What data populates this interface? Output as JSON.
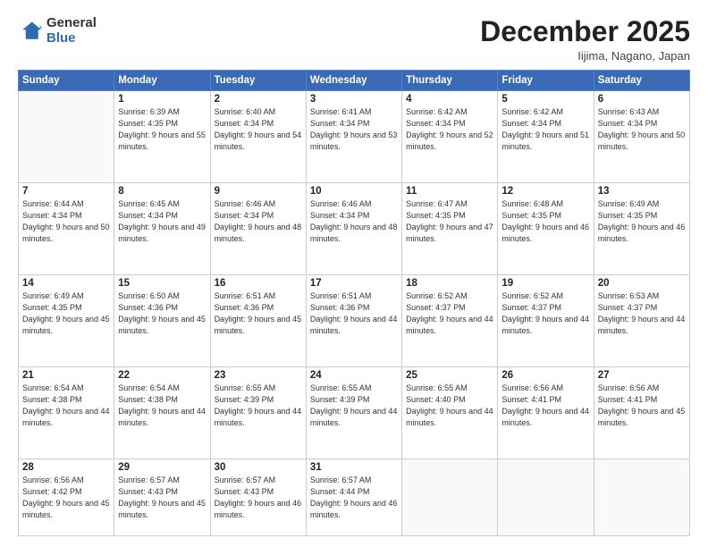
{
  "logo": {
    "general": "General",
    "blue": "Blue"
  },
  "title": "December 2025",
  "location": "Iijima, Nagano, Japan",
  "weekdays": [
    "Sunday",
    "Monday",
    "Tuesday",
    "Wednesday",
    "Thursday",
    "Friday",
    "Saturday"
  ],
  "weeks": [
    [
      {
        "day": "",
        "info": ""
      },
      {
        "day": "1",
        "info": "Sunrise: 6:39 AM\nSunset: 4:35 PM\nDaylight: 9 hours\nand 55 minutes."
      },
      {
        "day": "2",
        "info": "Sunrise: 6:40 AM\nSunset: 4:34 PM\nDaylight: 9 hours\nand 54 minutes."
      },
      {
        "day": "3",
        "info": "Sunrise: 6:41 AM\nSunset: 4:34 PM\nDaylight: 9 hours\nand 53 minutes."
      },
      {
        "day": "4",
        "info": "Sunrise: 6:42 AM\nSunset: 4:34 PM\nDaylight: 9 hours\nand 52 minutes."
      },
      {
        "day": "5",
        "info": "Sunrise: 6:42 AM\nSunset: 4:34 PM\nDaylight: 9 hours\nand 51 minutes."
      },
      {
        "day": "6",
        "info": "Sunrise: 6:43 AM\nSunset: 4:34 PM\nDaylight: 9 hours\nand 50 minutes."
      }
    ],
    [
      {
        "day": "7",
        "info": "Sunrise: 6:44 AM\nSunset: 4:34 PM\nDaylight: 9 hours\nand 50 minutes."
      },
      {
        "day": "8",
        "info": "Sunrise: 6:45 AM\nSunset: 4:34 PM\nDaylight: 9 hours\nand 49 minutes."
      },
      {
        "day": "9",
        "info": "Sunrise: 6:46 AM\nSunset: 4:34 PM\nDaylight: 9 hours\nand 48 minutes."
      },
      {
        "day": "10",
        "info": "Sunrise: 6:46 AM\nSunset: 4:34 PM\nDaylight: 9 hours\nand 48 minutes."
      },
      {
        "day": "11",
        "info": "Sunrise: 6:47 AM\nSunset: 4:35 PM\nDaylight: 9 hours\nand 47 minutes."
      },
      {
        "day": "12",
        "info": "Sunrise: 6:48 AM\nSunset: 4:35 PM\nDaylight: 9 hours\nand 46 minutes."
      },
      {
        "day": "13",
        "info": "Sunrise: 6:49 AM\nSunset: 4:35 PM\nDaylight: 9 hours\nand 46 minutes."
      }
    ],
    [
      {
        "day": "14",
        "info": "Sunrise: 6:49 AM\nSunset: 4:35 PM\nDaylight: 9 hours\nand 45 minutes."
      },
      {
        "day": "15",
        "info": "Sunrise: 6:50 AM\nSunset: 4:36 PM\nDaylight: 9 hours\nand 45 minutes."
      },
      {
        "day": "16",
        "info": "Sunrise: 6:51 AM\nSunset: 4:36 PM\nDaylight: 9 hours\nand 45 minutes."
      },
      {
        "day": "17",
        "info": "Sunrise: 6:51 AM\nSunset: 4:36 PM\nDaylight: 9 hours\nand 44 minutes."
      },
      {
        "day": "18",
        "info": "Sunrise: 6:52 AM\nSunset: 4:37 PM\nDaylight: 9 hours\nand 44 minutes."
      },
      {
        "day": "19",
        "info": "Sunrise: 6:52 AM\nSunset: 4:37 PM\nDaylight: 9 hours\nand 44 minutes."
      },
      {
        "day": "20",
        "info": "Sunrise: 6:53 AM\nSunset: 4:37 PM\nDaylight: 9 hours\nand 44 minutes."
      }
    ],
    [
      {
        "day": "21",
        "info": "Sunrise: 6:54 AM\nSunset: 4:38 PM\nDaylight: 9 hours\nand 44 minutes."
      },
      {
        "day": "22",
        "info": "Sunrise: 6:54 AM\nSunset: 4:38 PM\nDaylight: 9 hours\nand 44 minutes."
      },
      {
        "day": "23",
        "info": "Sunrise: 6:55 AM\nSunset: 4:39 PM\nDaylight: 9 hours\nand 44 minutes."
      },
      {
        "day": "24",
        "info": "Sunrise: 6:55 AM\nSunset: 4:39 PM\nDaylight: 9 hours\nand 44 minutes."
      },
      {
        "day": "25",
        "info": "Sunrise: 6:55 AM\nSunset: 4:40 PM\nDaylight: 9 hours\nand 44 minutes."
      },
      {
        "day": "26",
        "info": "Sunrise: 6:56 AM\nSunset: 4:41 PM\nDaylight: 9 hours\nand 44 minutes."
      },
      {
        "day": "27",
        "info": "Sunrise: 6:56 AM\nSunset: 4:41 PM\nDaylight: 9 hours\nand 45 minutes."
      }
    ],
    [
      {
        "day": "28",
        "info": "Sunrise: 6:56 AM\nSunset: 4:42 PM\nDaylight: 9 hours\nand 45 minutes."
      },
      {
        "day": "29",
        "info": "Sunrise: 6:57 AM\nSunset: 4:43 PM\nDaylight: 9 hours\nand 45 minutes."
      },
      {
        "day": "30",
        "info": "Sunrise: 6:57 AM\nSunset: 4:43 PM\nDaylight: 9 hours\nand 46 minutes."
      },
      {
        "day": "31",
        "info": "Sunrise: 6:57 AM\nSunset: 4:44 PM\nDaylight: 9 hours\nand 46 minutes."
      },
      {
        "day": "",
        "info": ""
      },
      {
        "day": "",
        "info": ""
      },
      {
        "day": "",
        "info": ""
      }
    ]
  ]
}
